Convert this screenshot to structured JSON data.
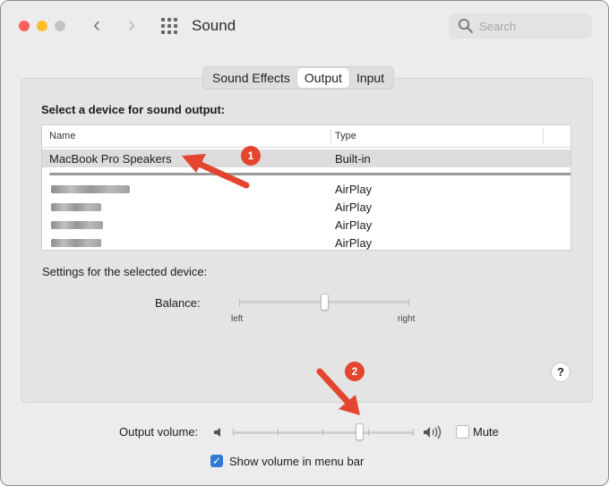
{
  "window": {
    "title": "Sound"
  },
  "search": {
    "placeholder": "Search"
  },
  "tabs": [
    {
      "label": "Sound Effects",
      "active": false
    },
    {
      "label": "Output",
      "active": true
    },
    {
      "label": "Input",
      "active": false
    }
  ],
  "output": {
    "heading": "Select a device for sound output:",
    "columns": {
      "name": "Name",
      "type": "Type"
    },
    "devices": [
      {
        "name": "MacBook Pro Speakers",
        "type": "Built-in",
        "selected": true
      },
      {
        "name": "",
        "type": "AirPlay",
        "selected": false
      },
      {
        "name": "",
        "type": "AirPlay",
        "selected": false
      },
      {
        "name": "",
        "type": "AirPlay",
        "selected": false
      },
      {
        "name": "",
        "type": "AirPlay",
        "selected": false
      }
    ],
    "settings_label": "Settings for the selected device:",
    "balance": {
      "label": "Balance:",
      "left": "left",
      "right": "right",
      "value": 0.5
    }
  },
  "help_label": "?",
  "volume": {
    "label": "Output volume:",
    "value": 0.7,
    "mute_label": "Mute",
    "muted": false
  },
  "menu_bar": {
    "label": "Show volume in menu bar",
    "checked": true
  },
  "annotations": [
    {
      "label": "1"
    },
    {
      "label": "2"
    }
  ],
  "icons": {
    "close": "close-button",
    "minimize": "minimize-button",
    "zoom": "zoom-button",
    "back": "chevron-left-icon",
    "forward": "chevron-right-icon",
    "grid": "grid-icon",
    "search": "search-icon",
    "speaker_low": "speaker-low-icon",
    "speaker_high": "speaker-high-icon"
  },
  "colors": {
    "close": "#fe5f57",
    "minimize": "#febc2e",
    "zoom": "#c4c4c4",
    "accent": "#2f79d8",
    "annotation": "#e4452f"
  }
}
